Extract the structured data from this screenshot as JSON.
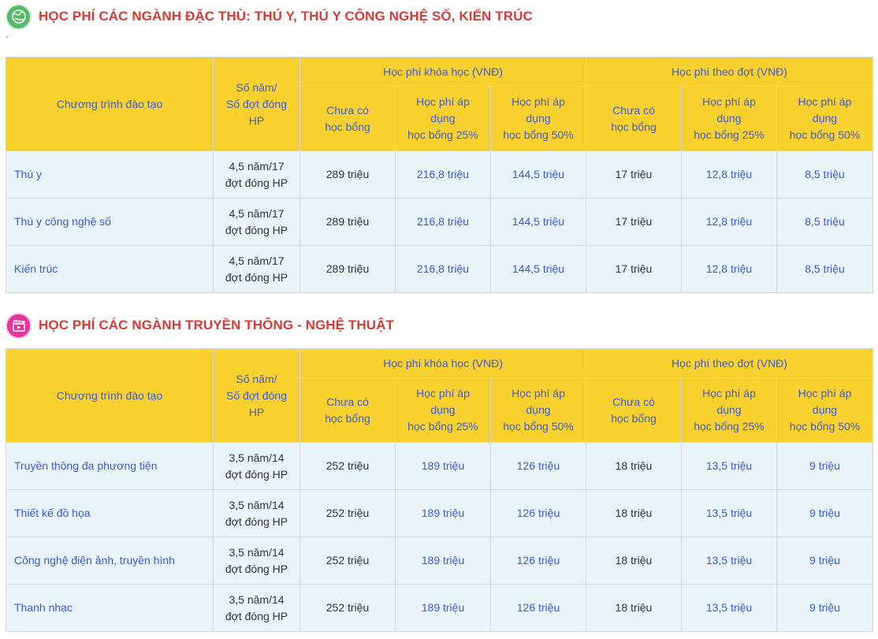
{
  "section1": {
    "icon": "globe-icon",
    "title": "HỌC PHÍ CÁC NGÀNH ĐẶC THÙ: THÚ Y, THÚ Y CÔNG NGHỆ SỐ, KIẾN TRÚC",
    "note": "`"
  },
  "section2": {
    "icon": "film-clapper-icon",
    "title": "HỌC PHÍ CÁC NGÀNH TRUYỀN THÔNG - NGHỆ THUẬT"
  },
  "colors": {
    "header_bg": "#f9d12e",
    "row_bg": "#e8f4f8",
    "title_red": "#d63b36",
    "accent_blue": "#3b5bdb"
  },
  "headers": {
    "program": "Chương trình đào tạo",
    "years_line1": "Số năm/",
    "years_line2": "Số đợt đóng",
    "years_line3": "HP",
    "course_fee": "Học phí khóa học (VNĐ)",
    "term_fee": "Học phí theo đợt (VNĐ)",
    "no_scholarship_line1": "Chưa có",
    "no_scholarship_line2": "học bổng",
    "apply_line1": "Học phí áp",
    "apply_line2": "dụng",
    "schol25": "học bổng 25%",
    "schol50": "học bổng 50%"
  },
  "table1": [
    {
      "program": "Thú y",
      "years1": "4,5 năm/17",
      "years2": "đợt đóng HP",
      "c0": "289 triệu",
      "c25": "216,8 triệu",
      "c50": "144,5 triệu",
      "t0": "17 triệu",
      "t25": "12,8 triệu",
      "t50": "8,5 triệu"
    },
    {
      "program": "Thú y công nghệ số",
      "years1": "4,5 năm/17",
      "years2": "đợt đóng HP",
      "c0": "289 triệu",
      "c25": "216,8 triệu",
      "c50": "144,5 triệu",
      "t0": "17 triệu",
      "t25": "12,8 triệu",
      "t50": "8,5 triệu"
    },
    {
      "program": "Kiến trúc",
      "years1": "4,5 năm/17",
      "years2": "đợt đóng HP",
      "c0": "289 triệu",
      "c25": "216,8 triệu",
      "c50": "144,5 triệu",
      "t0": "17 triệu",
      "t25": "12,8 triệu",
      "t50": "8,5 triệu"
    }
  ],
  "table2": [
    {
      "program": "Truyền thông đa phương tiện",
      "years1": "3,5 năm/14",
      "years2": "đợt đóng HP",
      "c0": "252 triệu",
      "c25": "189 triệu",
      "c50": "126 triệu",
      "t0": "18 triệu",
      "t25": "13,5 triệu",
      "t50": "9 triệu"
    },
    {
      "program": "Thiết kế đồ họa",
      "years1": "3,5 năm/14",
      "years2": "đợt đóng HP",
      "c0": "252 triệu",
      "c25": "189 triệu",
      "c50": "126 triệu",
      "t0": "18 triệu",
      "t25": "13,5 triệu",
      "t50": "9 triệu"
    },
    {
      "program": "Công nghệ điện ảnh, truyền hình",
      "years1": "3,5 năm/14",
      "years2": "đợt đóng HP",
      "c0": "252 triệu",
      "c25": "189 triệu",
      "c50": "126 triệu",
      "t0": "18 triệu",
      "t25": "13,5 triệu",
      "t50": "9 triệu"
    },
    {
      "program": "Thanh nhạc",
      "years1": "3,5 năm/14",
      "years2": "đợt đóng HP",
      "c0": "252 triệu",
      "c25": "189 triệu",
      "c50": "126 triệu",
      "t0": "18 triệu",
      "t25": "13,5 triệu",
      "t50": "9 triệu"
    }
  ]
}
